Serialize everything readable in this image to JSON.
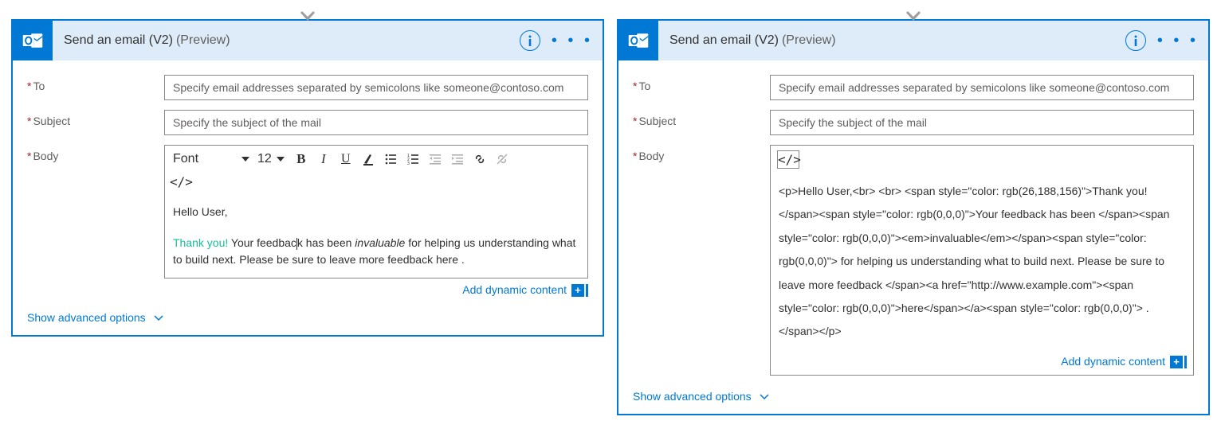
{
  "left": {
    "title": "Send an email (V2)",
    "preview": "(Preview)",
    "to_label": "To",
    "to_placeholder": "Specify email addresses separated by semicolons like someone@contoso.com",
    "subject_label": "Subject",
    "subject_placeholder": "Specify the subject of the mail",
    "body_label": "Body",
    "toolbar": {
      "font": "Font",
      "size": "12"
    },
    "greeting": "Hello User,",
    "thanks": "Thank you!",
    "body1": " Your feedbac",
    "body1b": "k has been ",
    "italic": "invaluable",
    "body2": " for helping us understanding what to build next. Please be sure to leave more feedback here .",
    "dynamic": "Add dynamic content",
    "advanced": "Show advanced options"
  },
  "right": {
    "title": "Send an email (V2)",
    "preview": "(Preview)",
    "to_label": "To",
    "to_placeholder": "Specify email addresses separated by semicolons like someone@contoso.com",
    "subject_label": "Subject",
    "subject_placeholder": "Specify the subject of the mail",
    "body_label": "Body",
    "code_toggle": "</>",
    "html_src": "<p>Hello User,<br>\n<br>\n<span style=\"color: rgb(26,188,156)\">Thank you! </span><span style=\"color: rgb(0,0,0)\">Your feedback has been </span><span style=\"color: rgb(0,0,0)\"><em>invaluable</em></span><span style=\"color: rgb(0,0,0)\"> for helping us understanding what to build next. Please be sure to leave more feedback </span><a href=\"http://www.example.com\"><span style=\"color: rgb(0,0,0)\">here</span></a><span style=\"color: rgb(0,0,0)\"> . </span></p>",
    "dynamic": "Add dynamic content",
    "advanced": "Show advanced options"
  }
}
